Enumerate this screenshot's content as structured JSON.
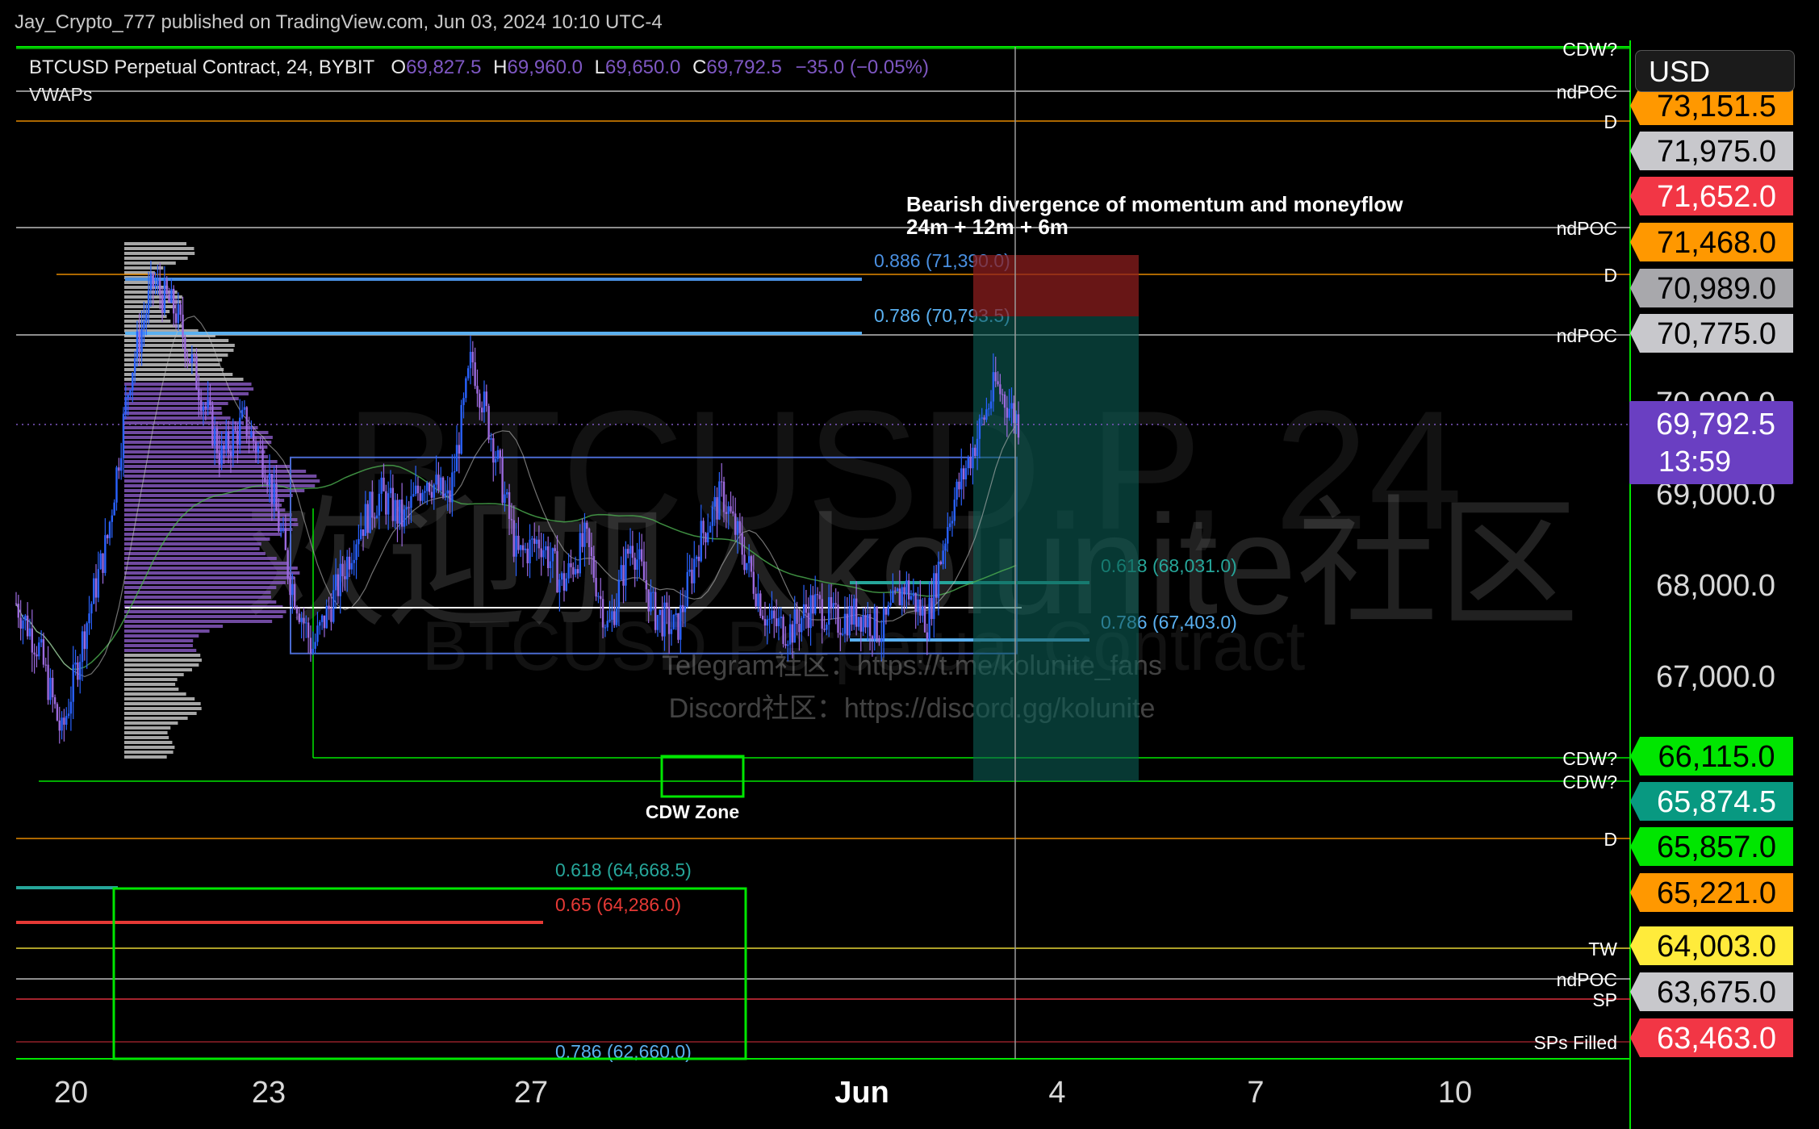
{
  "publisher": "Jay_Crypto_777 published on TradingView.com, Jun 03, 2024 10:10 UTC-4",
  "legend": {
    "symbol": "BTCUSD Perpetual Contract, 24, BYBIT",
    "open_key": "O",
    "open": "69,827.5",
    "high_key": "H",
    "high": "69,960.0",
    "low_key": "L",
    "low": "69,650.0",
    "close_key": "C",
    "close": "69,792.5",
    "change": "−35.0 (−0.05%)"
  },
  "indicator": "VWAPs",
  "currency": "USD",
  "watermark": {
    "big": "BTCUSD.P, 24",
    "sub": "BTCUSD Perpetual Contract",
    "overlay": "欢迎加入kolunite社区",
    "telegram": "Telegram社区：https://t.me/kolunite_fans",
    "discord": "Discord社区：https://discord.gg/kolunite"
  },
  "countdown": "13:59",
  "annotations": {
    "divergence_line1": "Bearish divergence of momentum and moneyflow",
    "divergence_line2": "24m + 12m + 6m",
    "cdw_zone": "CDW Zone"
  },
  "colors": {
    "background": "#000000",
    "candle_up": "#2962ff",
    "candle_down": "#9c6ade",
    "green": "#00e600",
    "orange": "#ff9800",
    "red": "#f23645",
    "teal": "#089981",
    "purple": "#7e57c2",
    "white_line": "#d0d0d0"
  },
  "chart_data": {
    "type": "candlestick",
    "timeframe": "24",
    "ylim": [
      62600,
      73900
    ],
    "x_ticks": [
      "20",
      "23",
      "27",
      "Jun",
      "4",
      "7",
      "10"
    ],
    "y_ticks": [
      67000,
      68000,
      69000,
      70000
    ],
    "y_tick_labels": [
      "67,000.0",
      "68,000.0",
      "69,000.0",
      "70,000.0"
    ],
    "current_price": 69792.5,
    "ohlc_last": {
      "open": 69827.5,
      "high": 69960.0,
      "low": 69650.0,
      "close": 69792.5
    },
    "price_path": [
      [
        0,
        67800
      ],
      [
        1,
        67300
      ],
      [
        2,
        66350
      ],
      [
        3,
        67500
      ],
      [
        4,
        68500
      ],
      [
        5,
        70300
      ],
      [
        6,
        71300
      ],
      [
        7,
        71000
      ],
      [
        8,
        70200
      ],
      [
        9,
        69400
      ],
      [
        10,
        69800
      ],
      [
        11,
        69300
      ],
      [
        12,
        68100
      ],
      [
        13,
        67300
      ],
      [
        14,
        67900
      ],
      [
        15,
        68600
      ],
      [
        16,
        69000
      ],
      [
        17,
        68700
      ],
      [
        18,
        69200
      ],
      [
        19,
        68900
      ],
      [
        20,
        70500
      ],
      [
        21,
        69500
      ],
      [
        22,
        68300
      ],
      [
        23,
        68500
      ],
      [
        24,
        68000
      ],
      [
        25,
        68500
      ],
      [
        26,
        67500
      ],
      [
        27,
        68500
      ],
      [
        28,
        67700
      ],
      [
        29,
        67500
      ],
      [
        30,
        68500
      ],
      [
        31,
        69000
      ],
      [
        32,
        68300
      ],
      [
        33,
        67600
      ],
      [
        34,
        67500
      ],
      [
        35,
        67800
      ],
      [
        36,
        67600
      ],
      [
        37,
        67700
      ],
      [
        38,
        67500
      ],
      [
        39,
        68000
      ],
      [
        40,
        67600
      ],
      [
        41,
        68800
      ],
      [
        42,
        69500
      ],
      [
        43,
        70200
      ],
      [
        44,
        69790
      ]
    ],
    "levels": [
      {
        "price": 73700,
        "label": "CDW?",
        "color": "#00e600"
      },
      {
        "price": 73200,
        "label": "ndPOC",
        "color": "#d0d0d0"
      },
      {
        "price": 72900,
        "label": "D",
        "color": "#ff9800"
      },
      {
        "price": 71530,
        "label": "ndPOC",
        "color": "#d0d0d0"
      },
      {
        "price": 71000,
        "label": "D",
        "color": "#ff9800"
      },
      {
        "price": 70330,
        "label": "ndPOC",
        "color": "#d0d0d0"
      },
      {
        "price": 66115,
        "label": "CDW?",
        "color": "#00e600"
      },
      {
        "price": 65874.5,
        "label": "CDW?",
        "color": "#00e600"
      },
      {
        "price": 65260,
        "label": "D",
        "color": "#ff9800"
      },
      {
        "price": 63950,
        "label": "TW",
        "color": "#ffeb3b"
      },
      {
        "price": 63630,
        "label": "ndPOC",
        "color": "#d0d0d0"
      },
      {
        "price": 63470,
        "label": "SP",
        "color": "#f23645"
      },
      {
        "price": 63163,
        "label": "SPs Filled",
        "color": "#f23645"
      }
    ],
    "price_tags": [
      {
        "value": "73,151.5",
        "price": 73151.5,
        "bg": "#ff9800",
        "fg": "#000"
      },
      {
        "value": "71,975.0",
        "price": 71975.0,
        "bg": "#c8c8cc",
        "fg": "#000"
      },
      {
        "value": "71,652.0",
        "price": 71652.0,
        "bg": "#f23645",
        "fg": "#fff"
      },
      {
        "value": "71,468.0",
        "price": 71468.0,
        "bg": "#ff9800",
        "fg": "#000"
      },
      {
        "value": "70,989.0",
        "price": 70989.0,
        "bg": "#a8a8ac",
        "fg": "#000"
      },
      {
        "value": "70,775.0",
        "price": 70775.0,
        "bg": "#c8c8cc",
        "fg": "#000"
      },
      {
        "value": "66,115.0",
        "price": 66115.0,
        "bg": "#00e600",
        "fg": "#000"
      },
      {
        "value": "65,874.5",
        "price": 65874.5,
        "bg": "#089981",
        "fg": "#fff"
      },
      {
        "value": "65,857.0",
        "price": 65560.0,
        "bg": "#00e600",
        "fg": "#000"
      },
      {
        "value": "65,221.0",
        "price": 65060.0,
        "bg": "#ff9800",
        "fg": "#000"
      },
      {
        "value": "64,003.0",
        "price": 64480.0,
        "bg": "#ffeb3b",
        "fg": "#000"
      },
      {
        "value": "63,675.0",
        "price": 63975.0,
        "bg": "#c8c8cc",
        "fg": "#000"
      },
      {
        "value": "63,463.0",
        "price": 63463.0,
        "bg": "#f23645",
        "fg": "#fff"
      }
    ],
    "fibs": [
      {
        "label": "0.886 (71,390.0)",
        "price": 71390.0,
        "color": "#4a90e2"
      },
      {
        "label": "0.786 (70,793.5)",
        "price": 70793.5,
        "color": "#5ab0f0"
      },
      {
        "label": "0.618 (68,031.0)",
        "price": 68031.0,
        "color": "#26a69a"
      },
      {
        "label": "0.786 (67,403.0)",
        "price": 67403.0,
        "color": "#5ab0f0"
      },
      {
        "label": "0.618 (64,668.5)",
        "price": 64668.5,
        "color": "#26a69a"
      },
      {
        "label": "0.65 (64,286.0)",
        "price": 64286.0,
        "color": "#e53935"
      },
      {
        "label": "0.786 (62,660.0)",
        "price": 62660.0,
        "color": "#5ab0f0"
      }
    ],
    "short_position": {
      "entry": 70775.0,
      "stop": 71390.0,
      "target": 65874.5
    },
    "range_box": {
      "top": 69400,
      "bottom": 67250
    }
  }
}
